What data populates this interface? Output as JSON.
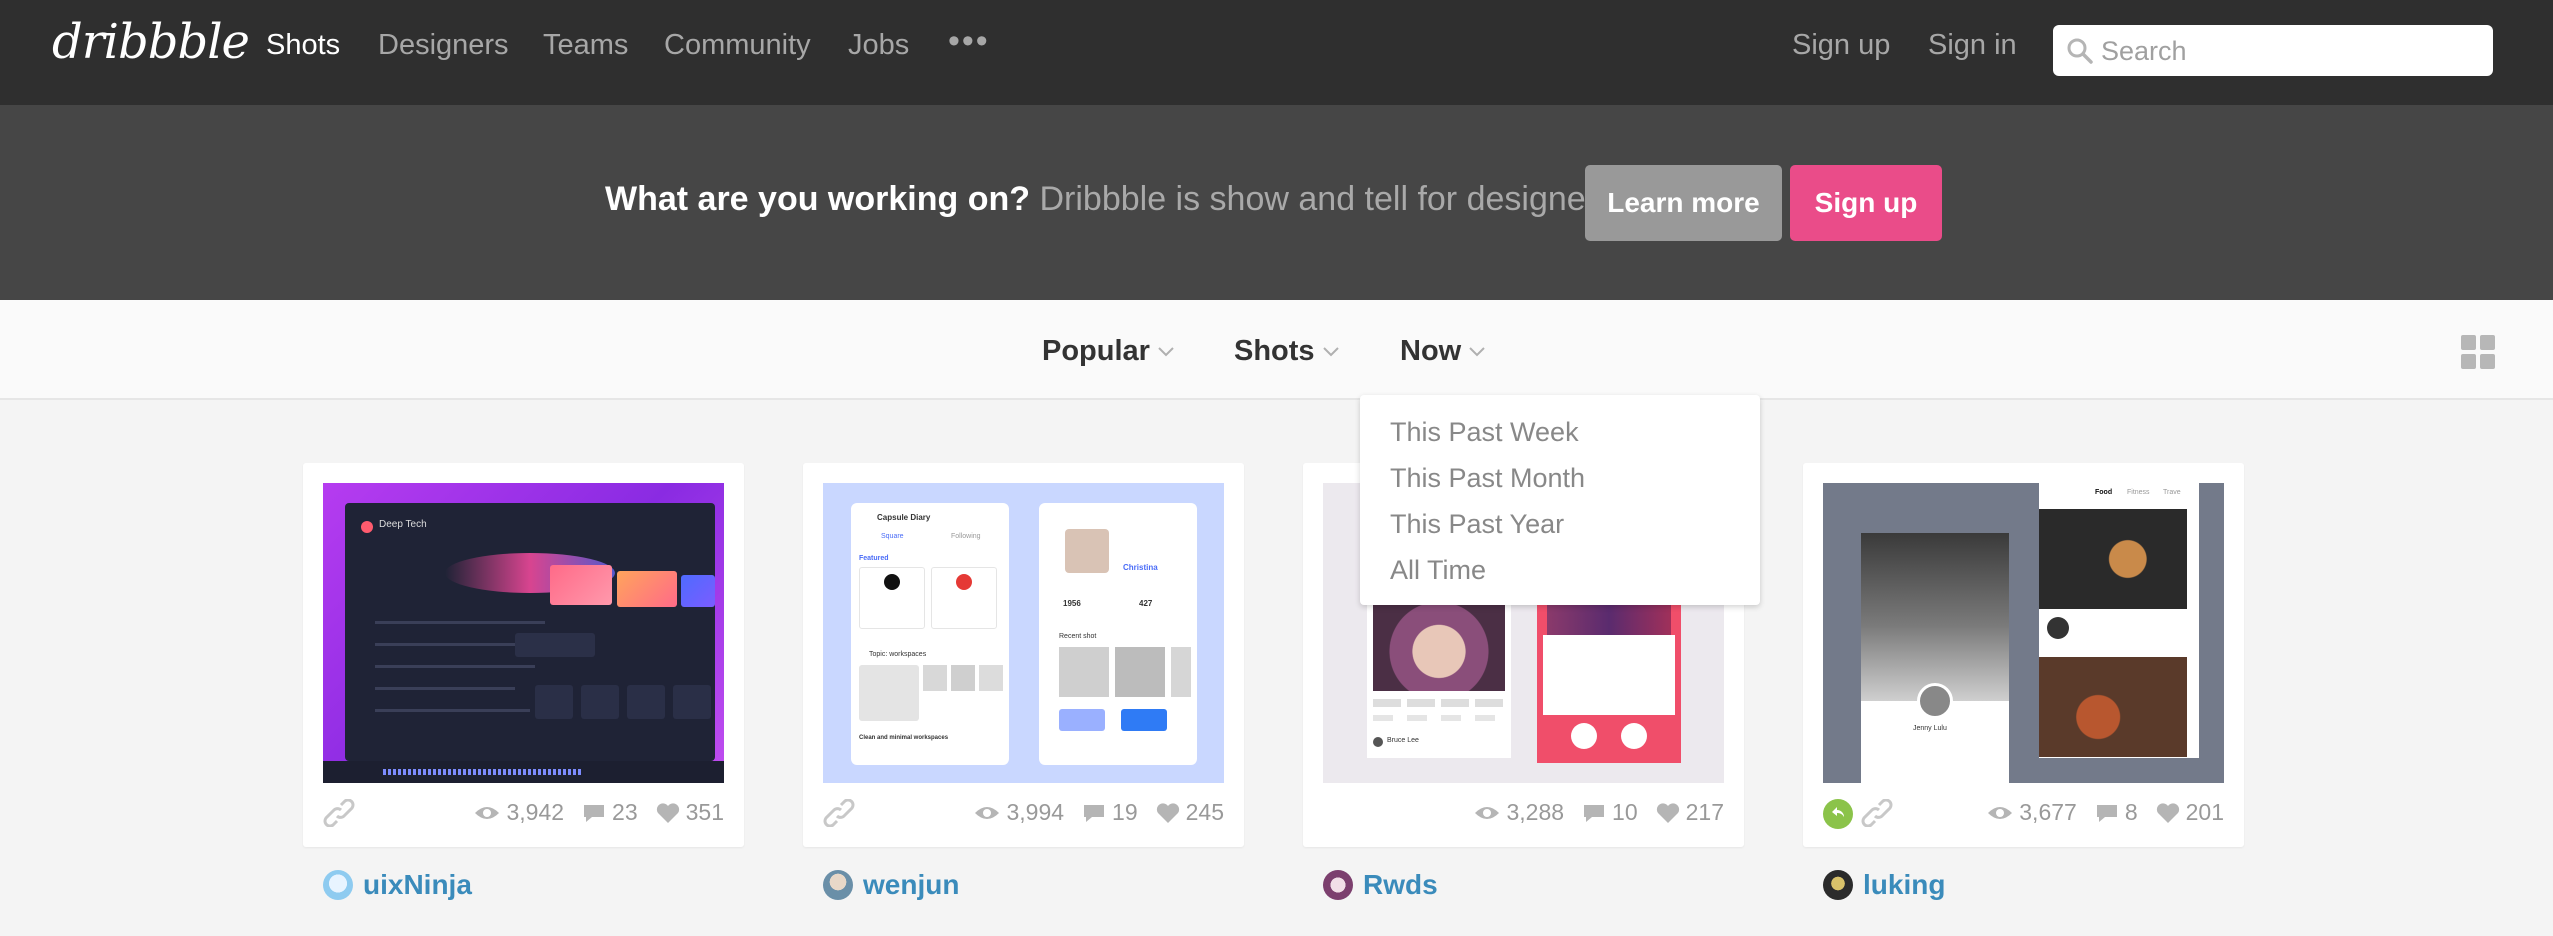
{
  "nav": {
    "logo": "dribbble",
    "links": [
      "Shots",
      "Designers",
      "Teams",
      "Community",
      "Jobs"
    ],
    "more": "•••",
    "signup": "Sign up",
    "signin": "Sign in",
    "search_placeholder": "Search"
  },
  "banner": {
    "question": "What are you working on?",
    "description": "Dribbble is show and tell for designers.",
    "learn_more": "Learn more",
    "signup": "Sign up"
  },
  "filters": {
    "sort": "Popular",
    "list": "Shots",
    "timeframe": "Now"
  },
  "dropdown": {
    "options": [
      "This Past Week",
      "This Past Month",
      "This Past Year",
      "All Time"
    ]
  },
  "shots": [
    {
      "views": "3,942",
      "comments": "23",
      "likes": "351",
      "author": "uixNinja",
      "rebound": false,
      "attachment": true
    },
    {
      "views": "3,994",
      "comments": "19",
      "likes": "245",
      "author": "wenjun",
      "rebound": false,
      "attachment": true
    },
    {
      "views": "3,288",
      "comments": "10",
      "likes": "217",
      "author": "Rwds",
      "rebound": false,
      "attachment": false
    },
    {
      "views": "3,677",
      "comments": "8",
      "likes": "201",
      "author": "luking",
      "rebound": true,
      "attachment": true
    }
  ],
  "thumb_text": {
    "deep_tech": "Deep Tech",
    "capsule": "Capsule Diary",
    "square": "Square",
    "following": "Following",
    "featured": "Featured",
    "christina": "Christina",
    "topic": "Topic: workspaces",
    "recent": "Recent shot",
    "clean": "Clean and minimal workspaces",
    "stat1": "1956",
    "stat2": "427",
    "food": "Food",
    "fitness": "Fitness",
    "travel": "Trave",
    "jenny": "Jenny Lulu",
    "bruce": "Bruce Lee"
  },
  "colors": {
    "nav_bg": "#2f2f2f",
    "banner_bg": "#464646",
    "accent_pink": "#ea4c89",
    "link_blue": "#3a8bbb",
    "rebound_green": "#8bc34a"
  }
}
